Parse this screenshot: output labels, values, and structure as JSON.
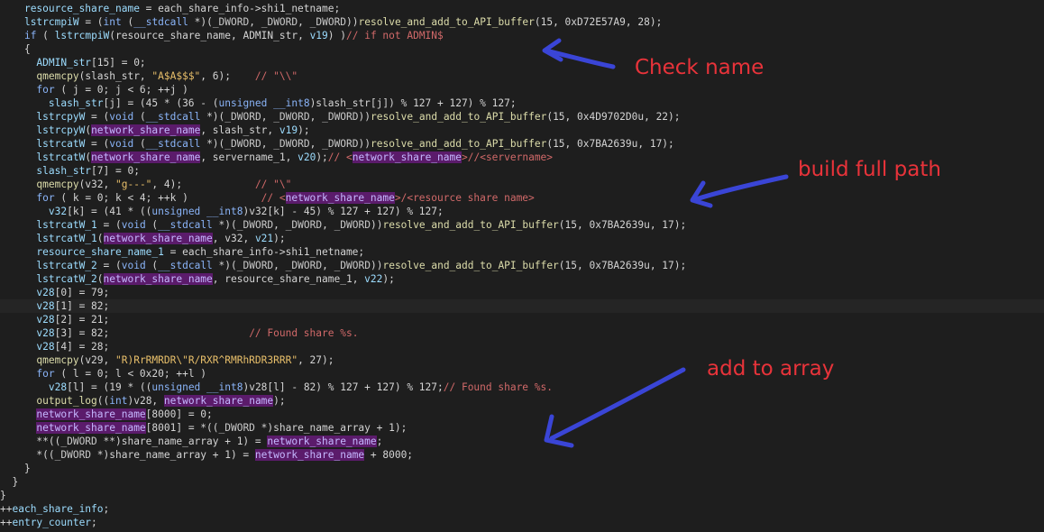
{
  "code_lines": [
    [
      "    ",
      {
        "t": "resource_share_name",
        "c": "var"
      },
      " = each_share_info->shi1_netname;"
    ],
    [
      "    ",
      {
        "t": "lstrcmpiW",
        "c": "var"
      },
      " = (",
      {
        "t": "int",
        "c": "kw"
      },
      " (",
      {
        "t": "__stdcall",
        "c": "kw"
      },
      " *)(",
      {
        "t": "_DWORD",
        "c": "typ"
      },
      ", ",
      {
        "t": "_DWORD",
        "c": "typ"
      },
      ", ",
      {
        "t": "_DWORD",
        "c": "typ"
      },
      "))",
      {
        "t": "resolve_and_add_to_API_buffer",
        "c": "fn"
      },
      "(15, 0xD72E57A9, 28);"
    ],
    [
      "    ",
      {
        "t": "if",
        "c": "kw"
      },
      " ( ",
      {
        "t": "lstrcmpiW",
        "c": "var"
      },
      "(resource_share_name, ADMIN_str, ",
      {
        "t": "v19",
        "c": "var"
      },
      ") )",
      {
        "t": "// if not ADMIN$",
        "c": "cmt"
      }
    ],
    [
      "    {"
    ],
    [
      "      ",
      {
        "t": "ADMIN_str",
        "c": "var"
      },
      "[15] = 0;"
    ],
    [
      "      ",
      {
        "t": "qmemcpy",
        "c": "fn"
      },
      "(slash_str, ",
      {
        "t": "\"A$A$$$\"",
        "c": "str"
      },
      ", 6);    ",
      {
        "t": "// \"\\\\\"",
        "c": "cmt"
      }
    ],
    [
      "      ",
      {
        "t": "for",
        "c": "kw"
      },
      " ( j = 0; j < 6; ++j )"
    ],
    [
      "        ",
      {
        "t": "slash_str",
        "c": "var"
      },
      "[j] = (45 * (36 - (",
      {
        "t": "unsigned",
        "c": "kw"
      },
      " ",
      {
        "t": "__int8",
        "c": "kw"
      },
      ")slash_str[j]) % 127 + 127) % 127;"
    ],
    [
      "      ",
      {
        "t": "lstrcpyW",
        "c": "var"
      },
      " = (",
      {
        "t": "void",
        "c": "kw"
      },
      " (",
      {
        "t": "__stdcall",
        "c": "kw"
      },
      " *)(",
      {
        "t": "_DWORD",
        "c": "typ"
      },
      ", ",
      {
        "t": "_DWORD",
        "c": "typ"
      },
      ", ",
      {
        "t": "_DWORD",
        "c": "typ"
      },
      "))",
      {
        "t": "resolve_and_add_to_API_buffer",
        "c": "fn"
      },
      "(15, 0x4D9702D0u, 22);"
    ],
    [
      "      ",
      {
        "t": "lstrcpyW",
        "c": "var"
      },
      "(",
      {
        "t": "network_share_name",
        "c": "hl"
      },
      ", slash_str, ",
      {
        "t": "v19",
        "c": "var"
      },
      ");"
    ],
    [
      "      ",
      {
        "t": "lstrcatW",
        "c": "var"
      },
      " = (",
      {
        "t": "void",
        "c": "kw"
      },
      " (",
      {
        "t": "__stdcall",
        "c": "kw"
      },
      " *)(",
      {
        "t": "_DWORD",
        "c": "typ"
      },
      ", ",
      {
        "t": "_DWORD",
        "c": "typ"
      },
      ", ",
      {
        "t": "_DWORD",
        "c": "typ"
      },
      "))",
      {
        "t": "resolve_and_add_to_API_buffer",
        "c": "fn"
      },
      "(15, 0x7BA2639u, 17);"
    ],
    [
      "      ",
      {
        "t": "lstrcatW",
        "c": "var"
      },
      "(",
      {
        "t": "network_share_name",
        "c": "hl"
      },
      ", servername_1, ",
      {
        "t": "v20",
        "c": "var"
      },
      ");",
      {
        "t": "// <",
        "c": "cmt"
      },
      {
        "t": "network_share_name",
        "c": "hl"
      },
      {
        "t": ">//<servername>",
        "c": "cmt"
      }
    ],
    [
      "      ",
      {
        "t": "slash_str",
        "c": "var"
      },
      "[7] = 0;"
    ],
    [
      "      ",
      {
        "t": "qmemcpy",
        "c": "fn"
      },
      "(v32, ",
      {
        "t": "\"g---\"",
        "c": "str"
      },
      ", 4);            ",
      {
        "t": "// \"\\\"",
        "c": "cmt"
      }
    ],
    [
      "      ",
      {
        "t": "for",
        "c": "kw"
      },
      " ( k = 0; k < 4; ++k )            ",
      {
        "t": "// <",
        "c": "cmt"
      },
      {
        "t": "network_share_name",
        "c": "hl"
      },
      {
        "t": ">/<resource share name>",
        "c": "cmt"
      }
    ],
    [
      "        ",
      {
        "t": "v32",
        "c": "var"
      },
      "[k] = (41 * ((",
      {
        "t": "unsigned",
        "c": "kw"
      },
      " ",
      {
        "t": "__int8",
        "c": "kw"
      },
      ")v32[k] - 45) % 127 + 127) % 127;"
    ],
    [
      "      ",
      {
        "t": "lstrcatW_1",
        "c": "var"
      },
      " = (",
      {
        "t": "void",
        "c": "kw"
      },
      " (",
      {
        "t": "__stdcall",
        "c": "kw"
      },
      " *)(",
      {
        "t": "_DWORD",
        "c": "typ"
      },
      ", ",
      {
        "t": "_DWORD",
        "c": "typ"
      },
      ", ",
      {
        "t": "_DWORD",
        "c": "typ"
      },
      "))",
      {
        "t": "resolve_and_add_to_API_buffer",
        "c": "fn"
      },
      "(15, 0x7BA2639u, 17);"
    ],
    [
      "      ",
      {
        "t": "lstrcatW_1",
        "c": "var"
      },
      "(",
      {
        "t": "network_share_name",
        "c": "hl"
      },
      ", v32, ",
      {
        "t": "v21",
        "c": "var"
      },
      ");"
    ],
    [
      "      ",
      {
        "t": "resource_share_name_1",
        "c": "var"
      },
      " = each_share_info->shi1_netname;"
    ],
    [
      "      ",
      {
        "t": "lstrcatW_2",
        "c": "var"
      },
      " = (",
      {
        "t": "void",
        "c": "kw"
      },
      " (",
      {
        "t": "__stdcall",
        "c": "kw"
      },
      " *)(",
      {
        "t": "_DWORD",
        "c": "typ"
      },
      ", ",
      {
        "t": "_DWORD",
        "c": "typ"
      },
      ", ",
      {
        "t": "_DWORD",
        "c": "typ"
      },
      "))",
      {
        "t": "resolve_and_add_to_API_buffer",
        "c": "fn"
      },
      "(15, 0x7BA2639u, 17);"
    ],
    [
      "      ",
      {
        "t": "lstrcatW_2",
        "c": "var"
      },
      "(",
      {
        "t": "network_share_name",
        "c": "hl"
      },
      ", resource_share_name_1, ",
      {
        "t": "v22",
        "c": "var"
      },
      ");"
    ],
    [
      "      ",
      {
        "t": "v28",
        "c": "var"
      },
      "[0] = 79;"
    ],
    [
      "      ",
      {
        "t": "v28",
        "c": "var"
      },
      "[1] = 82;"
    ],
    [
      "      ",
      {
        "t": "v28",
        "c": "var"
      },
      "[2] = 21;"
    ],
    [
      "      ",
      {
        "t": "v28",
        "c": "var"
      },
      "[3] = 82;                       ",
      {
        "t": "// Found share %s.",
        "c": "cmt"
      }
    ],
    [
      "      ",
      {
        "t": "v28",
        "c": "var"
      },
      "[4] = 28;"
    ],
    [
      "      ",
      {
        "t": "qmemcpy",
        "c": "fn"
      },
      "(v29, ",
      {
        "t": "\"R)RrRMRDR\\\"R/RXR^RMRhRDR3RRR\"",
        "c": "str"
      },
      ", 27);"
    ],
    [
      "      ",
      {
        "t": "for",
        "c": "kw"
      },
      " ( l = 0; l < 0x20; ++l )"
    ],
    [
      "        ",
      {
        "t": "v28",
        "c": "var"
      },
      "[l] = (19 * ((",
      {
        "t": "unsigned",
        "c": "kw"
      },
      " ",
      {
        "t": "__int8",
        "c": "kw"
      },
      ")v28[l] - 82) % 127 + 127) % 127;",
      {
        "t": "// Found share %s.",
        "c": "cmt"
      }
    ],
    [
      "      ",
      {
        "t": "output_log",
        "c": "fn"
      },
      "((",
      {
        "t": "int",
        "c": "kw"
      },
      ")v28, ",
      {
        "t": "network_share_name",
        "c": "hl"
      },
      ");"
    ],
    [
      "      ",
      {
        "t": "network_share_name",
        "c": "hl"
      },
      "[8000] = 0;"
    ],
    [
      "      ",
      {
        "t": "network_share_name",
        "c": "hl"
      },
      "[8001] = *((",
      {
        "t": "_DWORD",
        "c": "typ"
      },
      " *)share_name_array + 1);"
    ],
    [
      "      **((",
      {
        "t": "_DWORD",
        "c": "typ"
      },
      " **)share_name_array + 1) = ",
      {
        "t": "network_share_name",
        "c": "hl"
      },
      ";"
    ],
    [
      "      *((",
      {
        "t": "_DWORD",
        "c": "typ"
      },
      " *)share_name_array + 1) = ",
      {
        "t": "network_share_name",
        "c": "hl"
      },
      " + 8000;"
    ],
    [
      "    }"
    ],
    [
      "  }"
    ],
    [
      "}"
    ],
    [
      "++",
      {
        "t": "each_share_info",
        "c": "var"
      },
      ";"
    ],
    [
      "++",
      {
        "t": "entry_counter",
        "c": "var"
      },
      ";"
    ]
  ],
  "annotations": {
    "check_name": "Check name",
    "build_full_path": "build full path",
    "add_to_array": "add to array"
  },
  "colors": {
    "background": "#1e1e1e",
    "annotation_text": "#e8333a",
    "arrow": "#3a45d6",
    "highlight": "#5b1b6b"
  }
}
